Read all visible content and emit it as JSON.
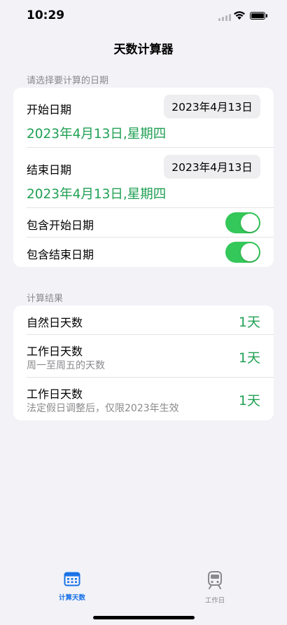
{
  "status_bar": {
    "time": "10:29"
  },
  "nav": {
    "title": "天数计算器"
  },
  "date_section": {
    "header": "请选择要计算的日期",
    "start": {
      "label": "开始日期",
      "picker_value": "2023年4月13日",
      "display": "2023年4月13日,星期四"
    },
    "end": {
      "label": "结束日期",
      "picker_value": "2023年4月13日",
      "display": "2023年4月13日,星期四"
    },
    "include_start": {
      "label": "包含开始日期",
      "on": true
    },
    "include_end": {
      "label": "包含结束日期",
      "on": true
    }
  },
  "result_section": {
    "header": "计算结果",
    "rows": [
      {
        "title": "自然日天数",
        "subtitle": "",
        "value": "1天"
      },
      {
        "title": "工作日天数",
        "subtitle": "周一至周五的天数",
        "value": "1天"
      },
      {
        "title": "工作日天数",
        "subtitle": "法定假日调整后，仅限2023年生效",
        "value": "1天"
      }
    ]
  },
  "tab_bar": {
    "tabs": [
      {
        "label": "计算天数",
        "icon": "calendar-icon",
        "active": true
      },
      {
        "label": "工作日",
        "icon": "train-icon",
        "active": false
      }
    ]
  },
  "colors": {
    "accent_green": "#21a054",
    "toggle_green": "#34c759",
    "tab_active_blue": "#1a73e8",
    "background": "#f2f2f7"
  }
}
